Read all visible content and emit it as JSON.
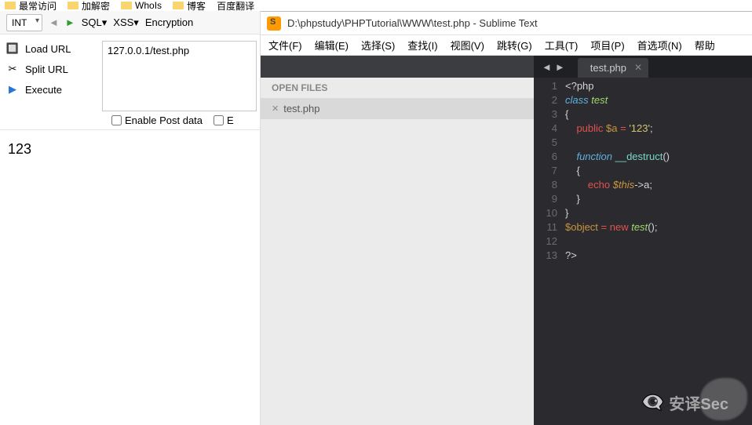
{
  "bookmarks": [
    "最常访问",
    "加解密",
    "WhoIs",
    "博客",
    "百度翻译"
  ],
  "toolbar": {
    "select": "INT",
    "items": [
      "SQL▾",
      "XSS▾",
      "Encryption"
    ]
  },
  "actions": {
    "load": "Load URL",
    "split": "Split URL",
    "execute": "Execute"
  },
  "url_value": "127.0.0.1/test.php",
  "checkboxes": {
    "post": "Enable Post data",
    "e": "E"
  },
  "page_output": "123",
  "sublime": {
    "title": "D:\\phpstudy\\PHPTutorial\\WWW\\test.php - Sublime Text",
    "menu": [
      "文件(F)",
      "编辑(E)",
      "选择(S)",
      "查找(I)",
      "视图(V)",
      "跳转(G)",
      "工具(T)",
      "项目(P)",
      "首选项(N)",
      "帮助"
    ],
    "open_files_label": "OPEN FILES",
    "file": "test.php",
    "tab": "test.php",
    "code": {
      "l1": "<?php",
      "l2a": "class ",
      "l2b": "test",
      "l3": "{",
      "l4a": "public ",
      "l4b": "$a",
      "l4c": " = ",
      "l4d": "'123'",
      "l4e": ";",
      "l5": "",
      "l6a": "function ",
      "l6b": "__destruct",
      "l6c": "()",
      "l7": "{",
      "l8a": "echo ",
      "l8b": "$this",
      "l8c": "->a;",
      "l9": "}",
      "l10": "}",
      "l11a": "$object",
      "l11b": " = ",
      "l11c": "new ",
      "l11d": "test",
      "l11e": "();",
      "l12": "",
      "l13": "?>"
    },
    "line_numbers": [
      "1",
      "2",
      "3",
      "4",
      "5",
      "6",
      "7",
      "8",
      "9",
      "10",
      "11",
      "12",
      "13"
    ]
  },
  "watermark": "安译Sec"
}
